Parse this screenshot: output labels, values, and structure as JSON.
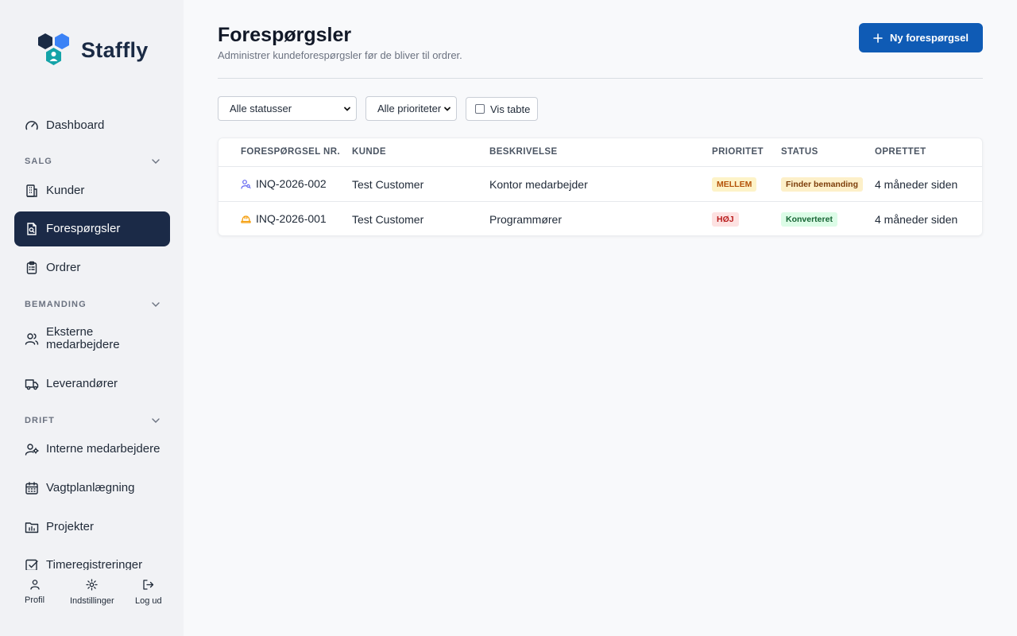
{
  "app": {
    "name": "Staffly"
  },
  "sidebar": {
    "dashboard": "Dashboard",
    "sections": {
      "salg": "SALG",
      "bemanding": "BEMANDING",
      "drift": "DRIFT"
    },
    "items": {
      "kunder": "Kunder",
      "forespoergsler": "Forespørgsler",
      "ordrer": "Ordrer",
      "eksterne": "Eksterne medarbejdere",
      "leverandoerer": "Leverandører",
      "interne": "Interne medarbejdere",
      "vagtplan": "Vagtplanlægning",
      "projekter": "Projekter",
      "timer": "Timeregistreringer"
    },
    "active": "forespoergsler",
    "footer": {
      "profil": "Profil",
      "indstillinger": "Indstillinger",
      "logud": "Log ud"
    }
  },
  "header": {
    "title": "Forespørgsler",
    "subtitle": "Administrer kundeforespørgsler før de bliver til ordrer.",
    "new_button": "Ny forespørgsel"
  },
  "filters": {
    "status": "Alle statusser",
    "priority": "Alle prioriteter",
    "show_lost": "Vis tabte",
    "show_lost_checked": false
  },
  "table": {
    "columns": {
      "nr": "FORESPØRGSEL NR.",
      "kunde": "KUNDE",
      "beskrivelse": "BESKRIVELSE",
      "prioritet": "PRIORITET",
      "status": "STATUS",
      "oprettet": "OPRETTET"
    },
    "rows": [
      {
        "icon": "user-search-icon",
        "nr": "INQ-2026-002",
        "kunde": "Test Customer",
        "beskrivelse": "Kontor medarbejder",
        "prioritet": "MELLEM",
        "status": "Finder bemanding",
        "oprettet": "4 måneder siden"
      },
      {
        "icon": "hard-hat-icon",
        "nr": "INQ-2026-001",
        "kunde": "Test Customer",
        "beskrivelse": "Programmører",
        "prioritet": "HØJ",
        "status": "Konverteret",
        "oprettet": "4 måneder siden"
      }
    ]
  },
  "colors": {
    "sidebar_bg": "#f1f2f5",
    "active_nav": "#1b2a47",
    "primary_button": "#0f5bb5",
    "priority_medium_bg": "#fdf3c8",
    "priority_medium_fg": "#b45309",
    "priority_high_bg": "#fde2e2",
    "priority_high_fg": "#b91c1c",
    "status_finding_bg": "#fdf0c9",
    "status_finding_fg": "#7c3d0a",
    "status_converted_bg": "#dcfce7",
    "status_converted_fg": "#166534"
  }
}
